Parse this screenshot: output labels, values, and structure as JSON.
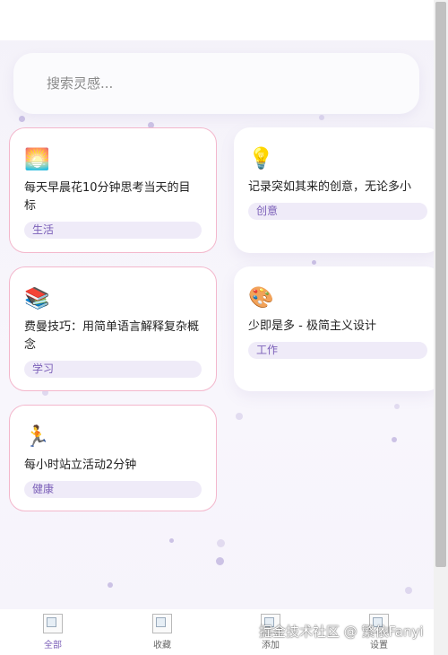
{
  "search": {
    "placeholder": "搜索灵感..."
  },
  "cards": [
    {
      "emoji": "🌅",
      "icon_name": "sunrise-icon",
      "text": "每天早晨花10分钟思考当天的目标",
      "tag": "生活"
    },
    {
      "emoji": "💡",
      "icon_name": "lightbulb-icon",
      "text": "记录突如其来的创意，无论多小",
      "tag": "创意"
    },
    {
      "emoji": "📚",
      "icon_name": "books-icon",
      "text": "费曼技巧：用简单语言解释复杂概念",
      "tag": "学习"
    },
    {
      "emoji": "🎨",
      "icon_name": "palette-icon",
      "text": "少即是多 - 极简主义设计",
      "tag": "工作"
    },
    {
      "emoji": "🏃",
      "icon_name": "runner-icon",
      "text": "每小时站立活动2分钟",
      "tag": "健康"
    }
  ],
  "nav": [
    {
      "label": "全部",
      "active": true
    },
    {
      "label": "收藏"
    },
    {
      "label": "添加"
    },
    {
      "label": "设置"
    }
  ],
  "watermark": "掘金技术社区 @ 繁依Fanyi",
  "colors": {
    "accent": "#7b5fb8",
    "tag_bg": "#efebf8",
    "selected_border": "#f3b7cc"
  }
}
